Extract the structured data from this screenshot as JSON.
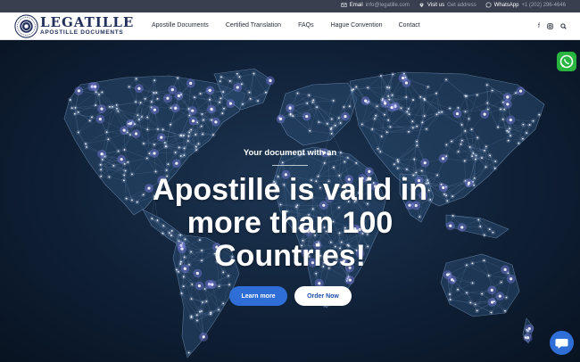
{
  "topbar": {
    "email_label": "Email",
    "email_value": "info@legatille.com",
    "visit_label": "Visit us",
    "visit_value": "Get address",
    "whatsapp_label": "WhatsApp",
    "whatsapp_value": "+1 (202) 296-4646"
  },
  "logo": {
    "title": "LEGATILLE",
    "subtitle": "APOSTILLE DOCUMENTS"
  },
  "nav": {
    "items": [
      {
        "label": "Apostille Documents"
      },
      {
        "label": "Certified Translation"
      },
      {
        "label": "FAQs"
      },
      {
        "label": "Hague Convention"
      },
      {
        "label": "Contact"
      }
    ],
    "icons": [
      "facebook-icon",
      "instagram-icon",
      "search-icon"
    ]
  },
  "hero": {
    "eyebrow": "Your document with an",
    "headline": "Apostille is valid in more than 100 Countries!",
    "primary_button": "Learn more",
    "secondary_button": "Order Now"
  },
  "colors": {
    "accent": "#2f6ed6",
    "topbar": "#3a3f4f",
    "hero_bg": "#0f2036",
    "whatsapp": "#28b43f",
    "brand_text": "#23305c"
  }
}
